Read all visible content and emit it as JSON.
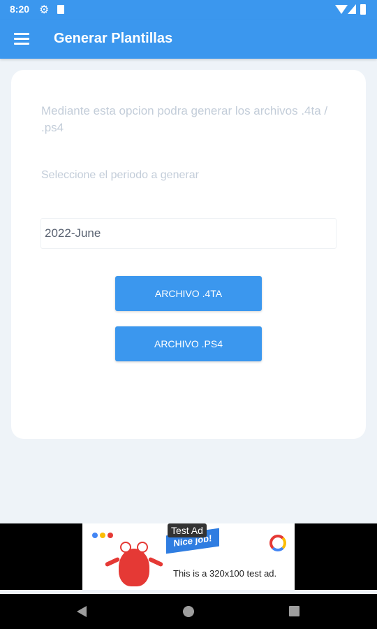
{
  "status_bar": {
    "time": "8:20",
    "icons": [
      "gear-icon",
      "sim-card-icon",
      "wifi-icon",
      "signal-icon",
      "battery-icon"
    ]
  },
  "app_bar": {
    "title": "Generar Plantillas",
    "menu_icon": "hamburger-menu-icon",
    "background_color": "#3b97ee"
  },
  "card": {
    "description": "Mediante esta opcion podra generar los archivos .4ta / .ps4",
    "period_label": "Seleccione el periodo a generar",
    "period_value": "2022-June",
    "buttons": {
      "archivo_4ta": "ARCHIVO .4TA",
      "archivo_ps4": "ARCHIVO .PS4"
    }
  },
  "ad": {
    "badge": "Test Ad",
    "flag_text": "Nice job!",
    "text": "This is a 320x100 test ad."
  },
  "nav_bar": {
    "icons": [
      "back-icon",
      "home-icon",
      "recents-icon"
    ]
  },
  "colors": {
    "accent": "#3b97ee",
    "page_background": "#eef3f8",
    "card_background": "#ffffff",
    "muted_text": "#c3cdd9"
  }
}
